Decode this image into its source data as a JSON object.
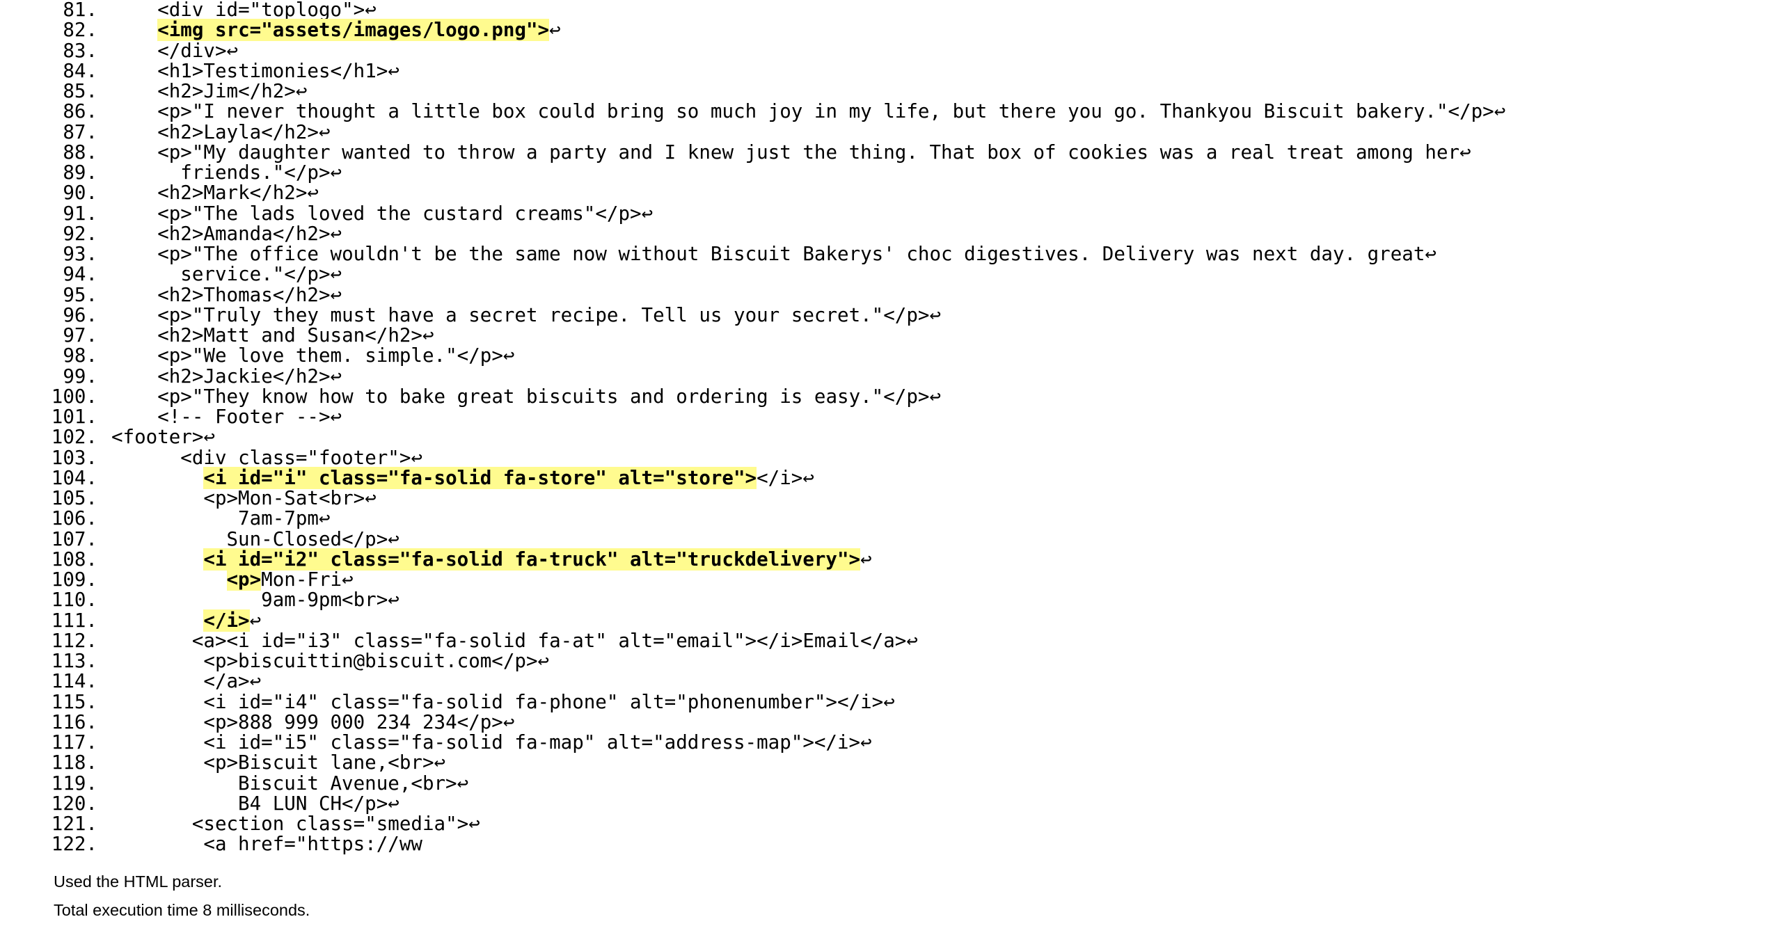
{
  "source": {
    "lines": [
      {
        "n": "81.",
        "indent": 4,
        "parts": [
          {
            "t": "<div id=\"toplogo\">"
          },
          {
            "t": "↩",
            "nl": true
          }
        ]
      },
      {
        "n": "82.",
        "indent": 4,
        "parts": [
          {
            "t": "<img src=\"assets/images/logo.png\">",
            "hl": true
          },
          {
            "t": "↩",
            "nl": true
          }
        ]
      },
      {
        "n": "83.",
        "indent": 4,
        "parts": [
          {
            "t": "</div>"
          },
          {
            "t": "↩",
            "nl": true
          }
        ]
      },
      {
        "n": "84.",
        "indent": 4,
        "parts": [
          {
            "t": "<h1>Testimonies</h1>"
          },
          {
            "t": "↩",
            "nl": true
          }
        ]
      },
      {
        "n": "85.",
        "indent": 4,
        "parts": [
          {
            "t": "<h2>Jim</h2>"
          },
          {
            "t": "↩",
            "nl": true
          }
        ]
      },
      {
        "n": "86.",
        "indent": 4,
        "parts": [
          {
            "t": "<p>\"I never thought a little box could bring so much joy in my life, but there you go. Thankyou Biscuit bakery.\"</p>"
          },
          {
            "t": "↩",
            "nl": true
          }
        ]
      },
      {
        "n": "87.",
        "indent": 4,
        "parts": [
          {
            "t": "<h2>Layla</h2>"
          },
          {
            "t": "↩",
            "nl": true
          }
        ]
      },
      {
        "n": "88.",
        "indent": 4,
        "parts": [
          {
            "t": "<p>\"My daughter wanted to throw a party and I knew just the thing. That box of cookies was a real treat among her"
          },
          {
            "t": "↩",
            "nl": true
          }
        ]
      },
      {
        "n": "89.",
        "indent": 6,
        "parts": [
          {
            "t": "friends.\"</p>"
          },
          {
            "t": "↩",
            "nl": true
          }
        ]
      },
      {
        "n": "90.",
        "indent": 4,
        "parts": [
          {
            "t": "<h2>Mark</h2>"
          },
          {
            "t": "↩",
            "nl": true
          }
        ]
      },
      {
        "n": "91.",
        "indent": 4,
        "parts": [
          {
            "t": "<p>\"The lads loved the custard creams\"</p>"
          },
          {
            "t": "↩",
            "nl": true
          }
        ]
      },
      {
        "n": "92.",
        "indent": 4,
        "parts": [
          {
            "t": "<h2>Amanda</h2>"
          },
          {
            "t": "↩",
            "nl": true
          }
        ]
      },
      {
        "n": "93.",
        "indent": 4,
        "parts": [
          {
            "t": "<p>\"The office wouldn't be the same now without Biscuit Bakerys' choc digestives. Delivery was next day. great"
          },
          {
            "t": "↩",
            "nl": true
          }
        ]
      },
      {
        "n": "94.",
        "indent": 6,
        "parts": [
          {
            "t": "service.\"</p>"
          },
          {
            "t": "↩",
            "nl": true
          }
        ]
      },
      {
        "n": "95.",
        "indent": 4,
        "parts": [
          {
            "t": "<h2>Thomas</h2>"
          },
          {
            "t": "↩",
            "nl": true
          }
        ]
      },
      {
        "n": "96.",
        "indent": 4,
        "parts": [
          {
            "t": "<p>\"Truly they must have a secret recipe. Tell us your secret.\"</p>"
          },
          {
            "t": "↩",
            "nl": true
          }
        ]
      },
      {
        "n": "97.",
        "indent": 4,
        "parts": [
          {
            "t": "<h2>Matt and Susan</h2>"
          },
          {
            "t": "↩",
            "nl": true
          }
        ]
      },
      {
        "n": "98.",
        "indent": 4,
        "parts": [
          {
            "t": "<p>\"We love them. simple.\"</p>"
          },
          {
            "t": "↩",
            "nl": true
          }
        ]
      },
      {
        "n": "99.",
        "indent": 4,
        "parts": [
          {
            "t": "<h2>Jackie</h2>"
          },
          {
            "t": "↩",
            "nl": true
          }
        ]
      },
      {
        "n": "100.",
        "indent": 4,
        "parts": [
          {
            "t": "<p>\"They know how to bake great biscuits and ordering is easy.\"</p>"
          },
          {
            "t": "↩",
            "nl": true
          }
        ]
      },
      {
        "n": "101.",
        "indent": 4,
        "parts": [
          {
            "t": "<!-- Footer -->"
          },
          {
            "t": "↩",
            "nl": true
          }
        ]
      },
      {
        "n": "102.",
        "indent": 0,
        "parts": [
          {
            "t": "<footer>"
          },
          {
            "t": "↩",
            "nl": true
          }
        ]
      },
      {
        "n": "103.",
        "indent": 6,
        "parts": [
          {
            "t": "<div class=\"footer\">"
          },
          {
            "t": "↩",
            "nl": true
          }
        ]
      },
      {
        "n": "104.",
        "indent": 8,
        "parts": [
          {
            "t": "<i id=\"i\" class=\"fa-solid fa-store\" alt=\"store\">",
            "hl": true
          },
          {
            "t": "</i>"
          },
          {
            "t": "↩",
            "nl": true
          }
        ]
      },
      {
        "n": "105.",
        "indent": 8,
        "parts": [
          {
            "t": "<p>Mon-Sat<br>"
          },
          {
            "t": "↩",
            "nl": true
          }
        ]
      },
      {
        "n": "106.",
        "indent": 11,
        "parts": [
          {
            "t": "7am-7pm"
          },
          {
            "t": "↩",
            "nl": true
          }
        ]
      },
      {
        "n": "107.",
        "indent": 10,
        "parts": [
          {
            "t": "Sun-Closed</p>"
          },
          {
            "t": "↩",
            "nl": true
          }
        ]
      },
      {
        "n": "108.",
        "indent": 8,
        "parts": [
          {
            "t": "<i id=\"i2\" class=\"fa-solid fa-truck\" alt=\"truckdelivery\">",
            "hl": true
          },
          {
            "t": "↩",
            "nl": true
          }
        ]
      },
      {
        "n": "109.",
        "indent": 10,
        "parts": [
          {
            "t": "<p>",
            "hl": true
          },
          {
            "t": "Mon-Fri"
          },
          {
            "t": "↩",
            "nl": true
          }
        ]
      },
      {
        "n": "110.",
        "indent": 13,
        "parts": [
          {
            "t": "9am-9pm<br>"
          },
          {
            "t": "↩",
            "nl": true
          }
        ]
      },
      {
        "n": "111.",
        "indent": 8,
        "parts": [
          {
            "t": "</i>",
            "hl": true
          },
          {
            "t": "↩",
            "nl": true
          }
        ]
      },
      {
        "n": "112.",
        "indent": 7,
        "parts": [
          {
            "t": "<a><i id=\"i3\" class=\"fa-solid fa-at\" alt=\"email\"></i>Email</a>"
          },
          {
            "t": "↩",
            "nl": true
          }
        ]
      },
      {
        "n": "113.",
        "indent": 8,
        "parts": [
          {
            "t": "<p>biscuittin@biscuit.com</p>"
          },
          {
            "t": "↩",
            "nl": true
          }
        ]
      },
      {
        "n": "114.",
        "indent": 8,
        "parts": [
          {
            "t": "</a>"
          },
          {
            "t": "↩",
            "nl": true
          }
        ]
      },
      {
        "n": "115.",
        "indent": 8,
        "parts": [
          {
            "t": "<i id=\"i4\" class=\"fa-solid fa-phone\" alt=\"phonenumber\"></i>"
          },
          {
            "t": "↩",
            "nl": true
          }
        ]
      },
      {
        "n": "116.",
        "indent": 8,
        "parts": [
          {
            "t": "<p>888 999 000 234 234</p>"
          },
          {
            "t": "↩",
            "nl": true
          }
        ]
      },
      {
        "n": "117.",
        "indent": 8,
        "parts": [
          {
            "t": "<i id=\"i5\" class=\"fa-solid fa-map\" alt=\"address-map\"></i>"
          },
          {
            "t": "↩",
            "nl": true
          }
        ]
      },
      {
        "n": "118.",
        "indent": 8,
        "parts": [
          {
            "t": "<p>Biscuit lane,<br>"
          },
          {
            "t": "↩",
            "nl": true
          }
        ]
      },
      {
        "n": "119.",
        "indent": 11,
        "parts": [
          {
            "t": "Biscuit Avenue,<br>"
          },
          {
            "t": "↩",
            "nl": true
          }
        ]
      },
      {
        "n": "120.",
        "indent": 11,
        "parts": [
          {
            "t": "B4 LUN CH</p>"
          },
          {
            "t": "↩",
            "nl": true
          }
        ]
      },
      {
        "n": "121.",
        "indent": 7,
        "parts": [
          {
            "t": "<section class=\"smedia\">"
          },
          {
            "t": "↩",
            "nl": true
          }
        ]
      },
      {
        "n": "122.",
        "indent": 8,
        "parts": [
          {
            "t": "<a href=\"https://ww"
          }
        ]
      }
    ]
  },
  "status": {
    "parser": "Used the HTML parser.",
    "timing": "Total execution time 8 milliseconds."
  }
}
